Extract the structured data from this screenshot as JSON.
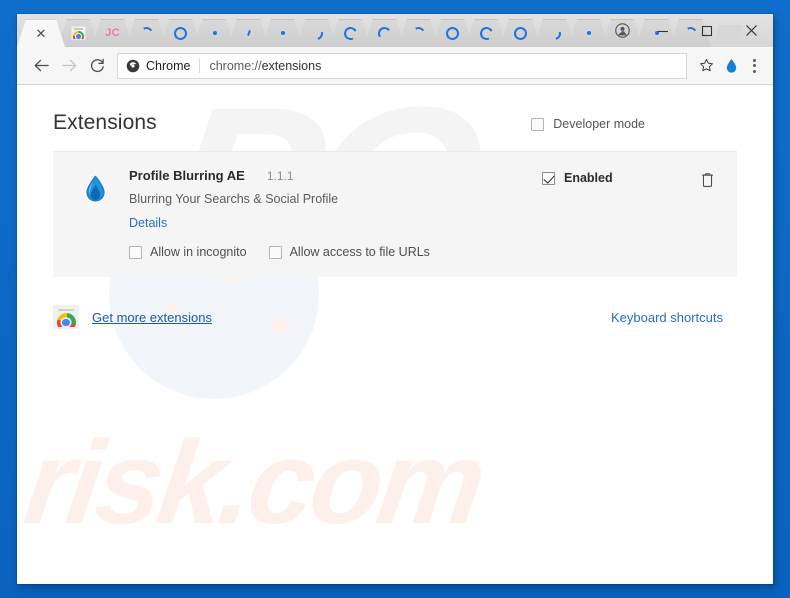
{
  "window": {
    "controls": {
      "avatar": "profile-avatar",
      "minimize": "–",
      "maximize": "□",
      "close": "✕"
    }
  },
  "tabstrip": {
    "active_tab": {
      "close_label": "✕"
    },
    "tabs": [
      {
        "icon": "chrome-web-store-icon",
        "label": ""
      },
      {
        "icon": "jc-favicon",
        "label": "JC"
      },
      {
        "icon": "loading-spinner-icon",
        "label": ""
      },
      {
        "icon": "loading-spinner-icon",
        "label": ""
      },
      {
        "icon": "loading-dot-icon",
        "label": ""
      },
      {
        "icon": "loading-tick-icon",
        "label": ""
      },
      {
        "icon": "loading-dot-icon",
        "label": ""
      },
      {
        "icon": "loading-spinner-icon",
        "label": ""
      },
      {
        "icon": "loading-spinner-icon",
        "label": ""
      },
      {
        "icon": "loading-spinner-icon",
        "label": ""
      },
      {
        "icon": "loading-spinner-icon",
        "label": ""
      },
      {
        "icon": "loading-spinner-icon",
        "label": ""
      },
      {
        "icon": "loading-spinner-icon",
        "label": ""
      },
      {
        "icon": "loading-spinner-icon",
        "label": ""
      },
      {
        "icon": "loading-spinner-icon",
        "label": ""
      },
      {
        "icon": "loading-dot-icon",
        "label": ""
      },
      {
        "icon": "loading-dot-icon",
        "label": ""
      },
      {
        "icon": "loading-dot-icon",
        "label": ""
      },
      {
        "icon": "loading-spinner-icon",
        "label": ""
      }
    ]
  },
  "toolbar": {
    "back_icon": "back-arrow-icon",
    "forward_icon": "forward-arrow-icon",
    "reload_icon": "reload-icon",
    "security_icon": "chrome-page-icon",
    "scheme_label": "Chrome",
    "url": "chrome://extensions",
    "url_scheme": "chrome://",
    "url_path": "extensions",
    "bookmark_icon": "star-icon",
    "extension_icon": "water-drop-extension-icon",
    "menu_icon": "three-dot-menu-icon"
  },
  "page": {
    "title": "Extensions",
    "developer_mode": {
      "label": "Developer mode",
      "checked": false
    },
    "extension": {
      "icon": "water-drop-icon",
      "name": "Profile Blurring AE",
      "version": "1.1.1",
      "description": "Blurring Your Searchs & Social Profile",
      "details_label": "Details",
      "allow_incognito": {
        "label": "Allow in incognito",
        "checked": false
      },
      "allow_file_urls": {
        "label": "Allow access to file URLs",
        "checked": false
      },
      "enabled": {
        "label": "Enabled",
        "checked": true
      },
      "remove_icon": "trash-icon"
    },
    "footer": {
      "store_icon": "chrome-web-store-icon",
      "get_more_label": "Get more extensions",
      "keyboard_shortcuts_label": "Keyboard shortcuts"
    },
    "watermark": {
      "top": "PC",
      "bottom": "risk.com"
    }
  },
  "colors": {
    "accent": "#0c67c4",
    "link": "#2a6dc9",
    "spinner": "#1a73e8",
    "card_bg": "#f5f5f5"
  }
}
